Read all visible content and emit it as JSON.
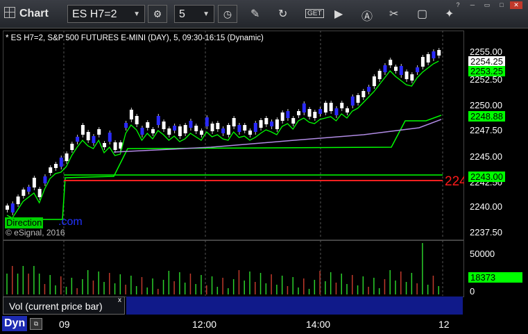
{
  "window": {
    "title": "Chart"
  },
  "toolbar": {
    "symbol": "ES H7=2",
    "interval": "5",
    "icons": [
      "chart-grid-icon",
      "settings-gear-icon",
      "clock-icon",
      "pencil-icon",
      "refresh-icon",
      "get-icon",
      "play-icon",
      "alert-icon",
      "tools-icon",
      "comment-icon",
      "twitter-icon"
    ]
  },
  "chart": {
    "header": "* ES H7=2, S&P 500 FUTURES E-MINI (DAY), 5, 09:30-16:15 (Dynamic)",
    "price_labels": [
      "2255.00",
      "2252.50",
      "2250.00",
      "2247.50",
      "2245.00",
      "2242.50",
      "2240.00",
      "2237.50"
    ],
    "last_price": "2254.25",
    "ma_fast": "2253.25",
    "ma_slow": "2248.88",
    "level": "2243.00",
    "red_level": "224",
    "watermark": "© eSignal, 2016",
    "badge": "Direction",
    "badge_suffix": ".com",
    "x_labels": [
      "09",
      "12:00",
      "14:00",
      "12"
    ]
  },
  "volume": {
    "axis_labels": [
      "50000",
      "0"
    ],
    "current": "18373",
    "label": "Vol (current price bar)",
    "close_mark": "x"
  },
  "bottom": {
    "mode": "Dyn",
    "fix_icon": "fix-icon"
  },
  "colors": {
    "up": "#ffffff",
    "down": "#2a2aff",
    "ma_green": "#00ff00",
    "ma_purple": "#b28ce6",
    "red": "#ff2020",
    "volume": "#2bd12b"
  }
}
